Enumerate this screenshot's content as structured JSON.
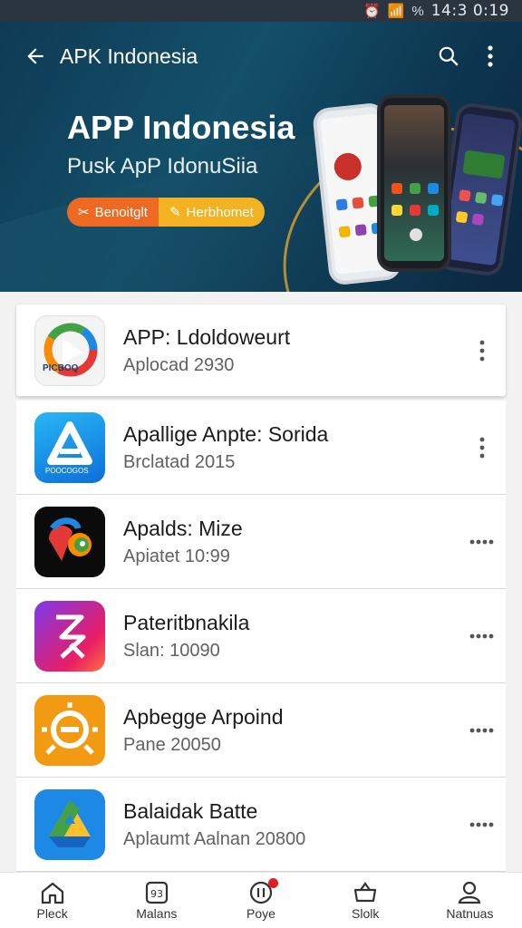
{
  "status_bar": {
    "time": "14:3 0:19",
    "battery_text": "%"
  },
  "header": {
    "title": "APK Indonesia",
    "hero_title": "APP Indonesia",
    "hero_subtitle": "Pusk ApP IdonuSiia",
    "buttons": [
      {
        "label": "Benoitglt",
        "color": "#ee6a22"
      },
      {
        "label": "Herbhomet",
        "color": "#f3b221"
      }
    ]
  },
  "apps": [
    {
      "name": "APP: Ldoldoweurt",
      "meta": "Aplocad 2930",
      "icon_text": "PICBOQ",
      "more": "vertical"
    },
    {
      "name": "Apallige Anpte: Sorida",
      "meta": "Brclatad 2015",
      "icon_text": "POOCOGOS",
      "more": "vertical"
    },
    {
      "name": "Apalds: Mize",
      "meta": "Apiatet 10:99",
      "icon_text": "",
      "more": "horizontal"
    },
    {
      "name": "Pateritbnakila",
      "meta": "Slan: 10090",
      "icon_text": "",
      "more": "horizontal"
    },
    {
      "name": "Apbegge Arpoind",
      "meta": "Pane 20050",
      "icon_text": "",
      "more": "horizontal"
    },
    {
      "name": "Balaidak Batte",
      "meta": "Aplaumt Aalnan 20800",
      "icon_text": "",
      "more": "horizontal"
    }
  ],
  "bottom_nav": [
    {
      "label": "Pleck",
      "icon": "home-icon"
    },
    {
      "label": "Malans",
      "icon": "apps-icon"
    },
    {
      "label": "Poye",
      "icon": "play-icon",
      "badge": true
    },
    {
      "label": "Slolk",
      "icon": "store-icon"
    },
    {
      "label": "Natnuas",
      "icon": "profile-icon"
    }
  ]
}
